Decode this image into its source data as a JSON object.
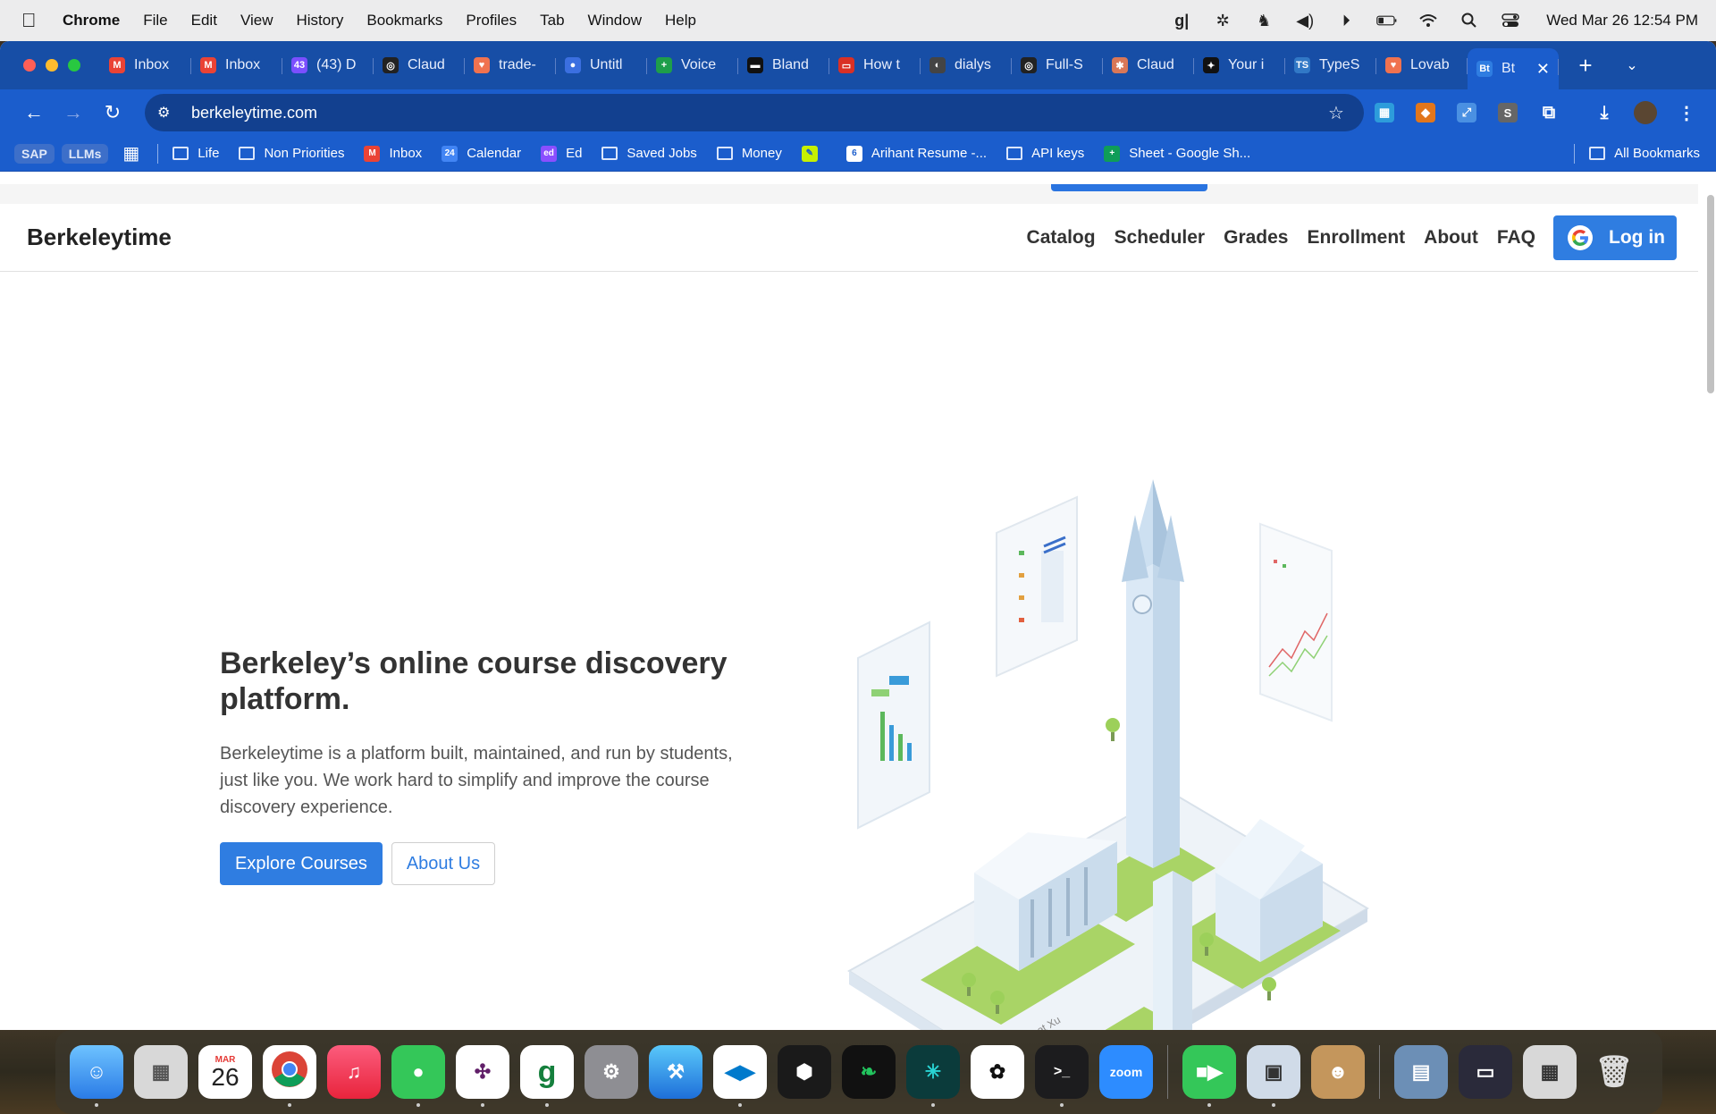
{
  "menubar": {
    "app": "Chrome",
    "items": [
      "File",
      "Edit",
      "View",
      "History",
      "Bookmarks",
      "Profiles",
      "Tab",
      "Window",
      "Help"
    ],
    "clock": "Wed Mar 26  12:54 PM"
  },
  "tabs": [
    {
      "label": "Inbox",
      "color": "#ea4335",
      "glyph": "M"
    },
    {
      "label": "Inbox",
      "color": "#ea4335",
      "glyph": "M"
    },
    {
      "label": "(43) D",
      "color": "#7b4fff",
      "glyph": "43"
    },
    {
      "label": "Claud",
      "color": "#222222",
      "glyph": "◎"
    },
    {
      "label": "trade-",
      "color": "#f0724f",
      "glyph": "♥"
    },
    {
      "label": "Untitl",
      "color": "#3b6fe0",
      "glyph": "●"
    },
    {
      "label": "Voice",
      "color": "#1e9e4a",
      "glyph": "+"
    },
    {
      "label": "Bland",
      "color": "#111111",
      "glyph": "▬"
    },
    {
      "label": "How t",
      "color": "#d93025",
      "glyph": "▭"
    },
    {
      "label": "dialys",
      "color": "#444444",
      "glyph": "◐"
    },
    {
      "label": "Full-S",
      "color": "#222222",
      "glyph": "◎"
    },
    {
      "label": "Claud",
      "color": "#d97757",
      "glyph": "✱"
    },
    {
      "label": "Your i",
      "color": "#111111",
      "glyph": "✦"
    },
    {
      "label": "TypeS",
      "color": "#3178c6",
      "glyph": "TS"
    },
    {
      "label": "Lovab",
      "color": "#f0724f",
      "glyph": "♥"
    }
  ],
  "active_tab": {
    "label": "Bt",
    "favicon": "Bt"
  },
  "address": "berkeleytime.com",
  "bookmarks": {
    "pills": [
      "SAP",
      "LLMs"
    ],
    "items": [
      {
        "label": "Life",
        "kind": "folder"
      },
      {
        "label": "Non Priorities",
        "kind": "folder"
      },
      {
        "label": "Inbox",
        "kind": "gmail"
      },
      {
        "label": "Calendar",
        "kind": "calendar"
      },
      {
        "label": "Ed",
        "kind": "ed"
      },
      {
        "label": "Saved Jobs",
        "kind": "folder"
      },
      {
        "label": "Money",
        "kind": "folder"
      },
      {
        "label": "",
        "kind": "pen"
      },
      {
        "label": "Arihant Resume -...",
        "kind": "overleaf"
      },
      {
        "label": "API keys",
        "kind": "folder"
      },
      {
        "label": "Sheet - Google Sh...",
        "kind": "sheets"
      }
    ],
    "all": "All Bookmarks"
  },
  "site": {
    "brand": "Berkeleytime",
    "nav": [
      "Catalog",
      "Scheduler",
      "Grades",
      "Enrollment",
      "About",
      "FAQ"
    ],
    "login": "Log in",
    "headline": "Berkeley’s online course discovery platform.",
    "description": "Berkeleytime is a platform built, maintained, and run by students, just like you. We work hard to simplify and improve the course discovery experience.",
    "primary_cta": "Explore Courses",
    "secondary_cta": "About Us",
    "credit": "© Janet Xu"
  },
  "dock": {
    "calendar_month": "MAR",
    "calendar_day": "26",
    "zoom_label": "zoom"
  },
  "colors": {
    "tabbar": "#174ea6",
    "toolbar": "#1b5dcc",
    "accent": "#2f7de1"
  }
}
